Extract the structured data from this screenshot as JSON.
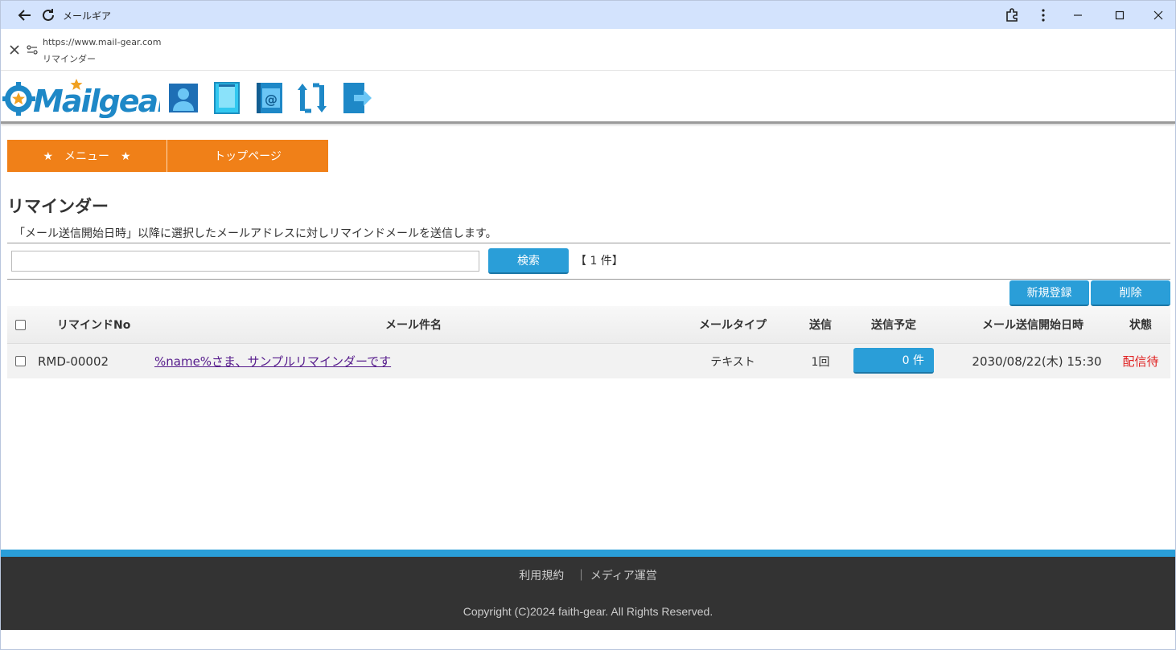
{
  "browser": {
    "window_title": "メールギア",
    "url": "https://www.mail-gear.com",
    "page_title": "リマインダー"
  },
  "logo": {
    "text": "Mailgear"
  },
  "header_icons": [
    "user-icon",
    "book-icon",
    "address-book-icon",
    "sync-icon",
    "logout-icon"
  ],
  "nav": {
    "menu_label": "★　メニュー　★",
    "top_label": "トップページ"
  },
  "main": {
    "title": "リマインダー",
    "description": "「メール送信開始日時」以降に選択したメールアドレスに対しリマインドメールを送信します。",
    "search": {
      "value": "",
      "placeholder": "",
      "button_label": "検索"
    },
    "result_count": "【 1 件】",
    "new_button_label": "新規登録",
    "delete_button_label": "削除"
  },
  "table": {
    "headers": {
      "no": "リマインドNo",
      "subject": "メール件名",
      "type": "メールタイプ",
      "sent": "送信",
      "scheduled": "送信予定",
      "start_datetime": "メール送信開始日時",
      "status": "状態"
    },
    "rows": [
      {
        "no": "RMD-00002",
        "subject": "%name%さま、サンプルリマインダーです",
        "type": "テキスト",
        "sent": "1回",
        "scheduled": "0 件",
        "start_datetime": "2030/08/22(木) 15:30",
        "status": "配信待"
      }
    ]
  },
  "footer": {
    "terms": "利用規約",
    "separator": "｜",
    "media": "メディア運営",
    "copyright": "Copyright (C)2024 faith-gear. All Rights Reserved."
  },
  "colors": {
    "accent_orange": "#f08018",
    "accent_blue": "#2a9ed8",
    "status_red": "#e02020",
    "footer_bg": "#333333"
  }
}
